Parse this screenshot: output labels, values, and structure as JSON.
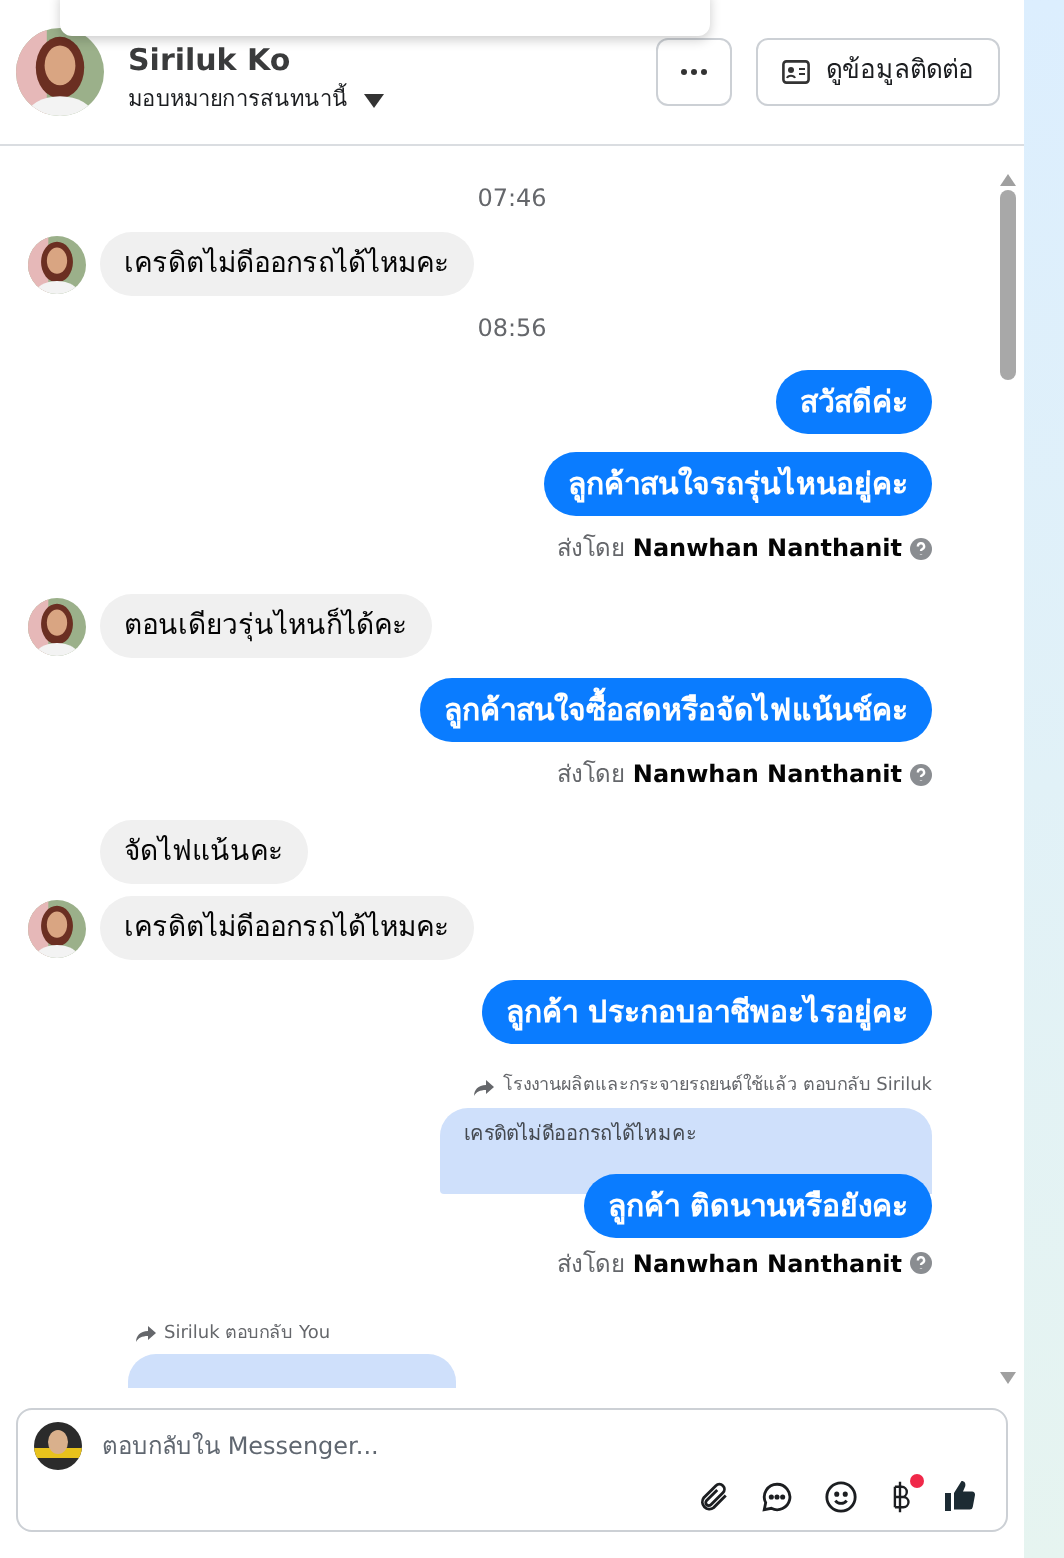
{
  "header": {
    "name": "Siriluk Ko",
    "assign_label": "มอบหมายการสนทนานี้",
    "contact_button": "ดูข้อมูลติดต่อ"
  },
  "messages": [
    {
      "kind": "time",
      "text": "07:46"
    },
    {
      "kind": "incoming",
      "text": "เครดิตไม่ดีออกรถได้ไหมคะ",
      "avatar": true
    },
    {
      "kind": "time",
      "text": "08:56"
    },
    {
      "kind": "outgoing",
      "text": "สวัสดีค่ะ"
    },
    {
      "kind": "outgoing",
      "text": "ลูกค้าสนใจรถรุ่นไหนอยู่คะ"
    },
    {
      "kind": "sent_by",
      "prefix": "ส่งโดย",
      "name": "Nanwhan Nanthanit"
    },
    {
      "kind": "incoming",
      "text": "ตอนเดียวรุ่นไหนก็ได้คะ",
      "avatar": true
    },
    {
      "kind": "outgoing",
      "text": "ลูกค้าสนใจซื้อสดหรือจัดไฟแน้นช์คะ"
    },
    {
      "kind": "sent_by",
      "prefix": "ส่งโดย",
      "name": "Nanwhan Nanthanit"
    },
    {
      "kind": "incoming",
      "text": "จัดไฟแน้นคะ",
      "avatar": false
    },
    {
      "kind": "incoming",
      "text": "เครดิตไม่ดีออกรถได้ไหมคะ",
      "avatar": true
    },
    {
      "kind": "outgoing",
      "text": "ลูกค้า ประกอบอาชีพอะไรอยู่คะ"
    },
    {
      "kind": "reply_out",
      "header": "โรงงานผลิตและกระจายรถยนต์ใช้แล้ว ตอบกลับ Siriluk",
      "quoted": "เครดิตไม่ดีออกรถได้ไหมคะ",
      "text": "ลูกค้า ติดนานหรือยังคะ"
    },
    {
      "kind": "sent_by",
      "prefix": "ส่งโดย",
      "name": "Nanwhan Nanthanit"
    },
    {
      "kind": "reply_in",
      "header": "Siriluk ตอบกลับ You"
    }
  ],
  "composer": {
    "placeholder": "ตอบกลับใน Messenger...",
    "notification_dot": true
  }
}
